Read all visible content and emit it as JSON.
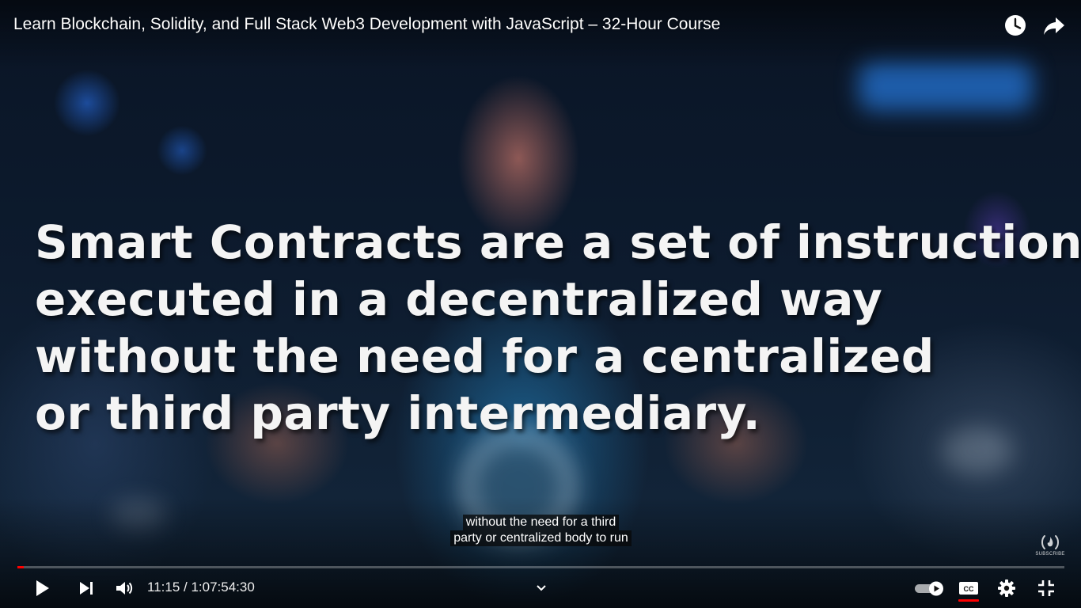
{
  "video": {
    "title": "Learn Blockchain, Solidity, and Full Stack Web3 Development with JavaScript – 32-Hour Course",
    "slide_text": [
      "Smart Contracts are a set of instructions",
      "executed in a decentralized way",
      "without the need for a centralized",
      "or third party intermediary."
    ],
    "captions": [
      "without the need for a third",
      "party or centralized body to run"
    ],
    "watermark_label": "SUBSCRIBE"
  },
  "top_actions": {
    "icons": [
      "watch-later-icon",
      "share-icon"
    ]
  },
  "player": {
    "current_time": "11:15",
    "duration": "1:07:54:30",
    "time_display": "11:15 / 1:07:54:30",
    "progress_fraction": 0.0028,
    "autoplay_on": true,
    "captions_on": true
  },
  "colors": {
    "progress": "#ff0000",
    "cc_indicator": "#ff0000",
    "text": "#ffffff"
  }
}
